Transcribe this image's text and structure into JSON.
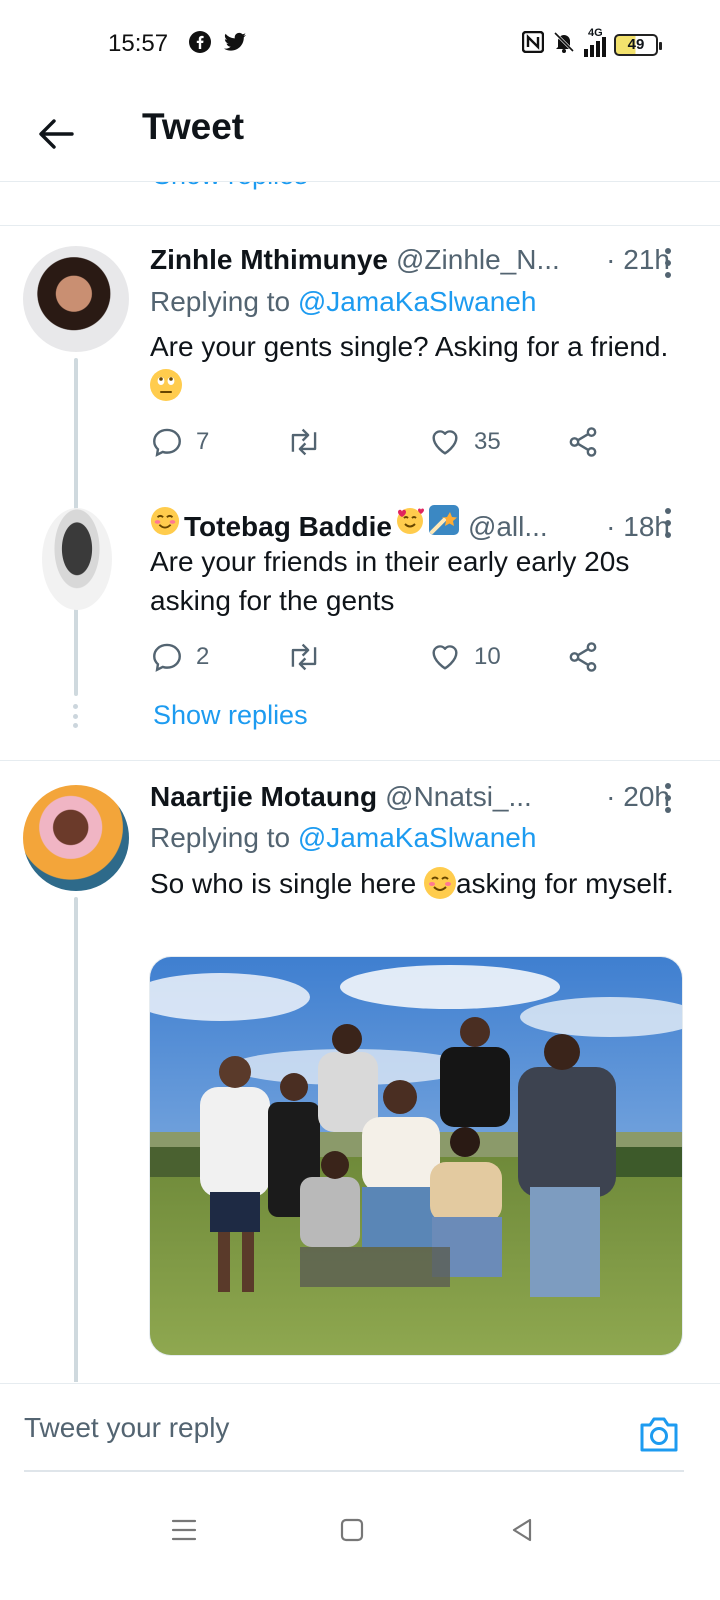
{
  "status_bar": {
    "time": "15:57",
    "network": "4G",
    "battery": "49"
  },
  "header": {
    "title": "Tweet"
  },
  "thread_above": {
    "show_replies": "Show replies"
  },
  "tweets": [
    {
      "name": "Zinhle Mthimunye",
      "handle": "@Zinhle_N...",
      "time": "· 21h",
      "replying_prefix": "Replying to ",
      "replying_to": "@JamaKaSlwaneh",
      "text_before_emoji": "Are your gents single? Asking for a friend. ",
      "emoji_icon": "face-with-rolling-eyes",
      "replies": "7",
      "retweets": "",
      "likes": "35"
    },
    {
      "name": "Totebag Baddie",
      "handle": "@all...",
      "time": "· 18h",
      "name_emoji_icons": [
        "smiling-face",
        "smiling-face-with-hearts",
        "shooting-star"
      ],
      "text": "Are your friends in their early early 20s asking for the gents",
      "replies": "2",
      "retweets": "",
      "likes": "10",
      "show_replies": "Show replies"
    },
    {
      "name": "Naartjie Motaung",
      "handle": "@Nnatsi_...",
      "time": "· 20h",
      "replying_prefix": "Replying to ",
      "replying_to": "@JamaKaSlwaneh",
      "text_before_emoji": "So who is single here ",
      "emoji_icon": "smiling-face",
      "text_after_emoji": "asking for myself.",
      "photo_icon": "group-photo-outdoors"
    }
  ],
  "composer": {
    "placeholder": "Tweet your reply"
  },
  "colors": {
    "accent": "#1d9bf0",
    "text": "#0f1419",
    "secondary": "#536471",
    "divider": "#e6ecf0"
  }
}
